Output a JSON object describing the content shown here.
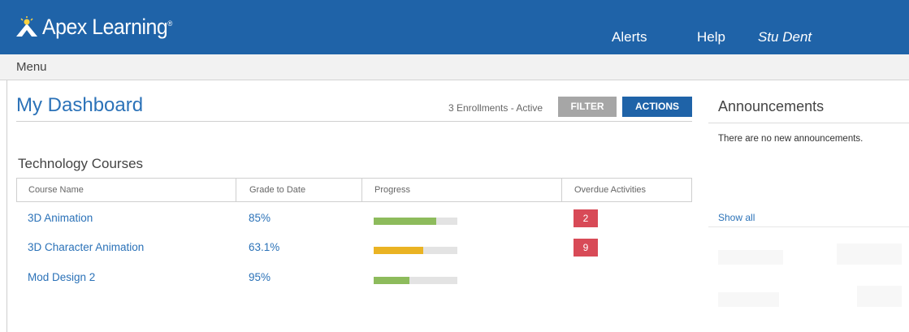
{
  "header": {
    "brand": "Apex Learning",
    "brand_mark": "®",
    "nav": {
      "alerts": "Alerts",
      "help": "Help",
      "user": "Stu Dent"
    }
  },
  "menubar": {
    "label": "Menu"
  },
  "dashboard": {
    "title": "My Dashboard",
    "enrollments": "3 Enrollments - Active",
    "filter_label": "FILTER",
    "actions_label": "ACTIONS"
  },
  "section": {
    "title": "Technology Courses",
    "columns": [
      "Course Name",
      "Grade to Date",
      "Progress",
      "Overdue Activities"
    ],
    "rows": [
      {
        "name": "3D Animation",
        "grade": "85%",
        "progress": 0.75,
        "progress_color": "#8dbb5c",
        "overdue": "2"
      },
      {
        "name": "3D Character Animation",
        "grade": "63.1%",
        "progress": 0.59,
        "progress_color": "#eab323",
        "overdue": "9"
      },
      {
        "name": "Mod Design 2",
        "grade": "95%",
        "progress": 0.43,
        "progress_color": "#8dbb5c",
        "overdue": ""
      }
    ]
  },
  "announcements": {
    "title": "Announcements",
    "empty": "There are no new announcements.",
    "show_all": "Show all"
  },
  "colors": {
    "brand_blue": "#1f63a8",
    "link_blue": "#2b72b8",
    "overdue_red": "#d84a57"
  }
}
